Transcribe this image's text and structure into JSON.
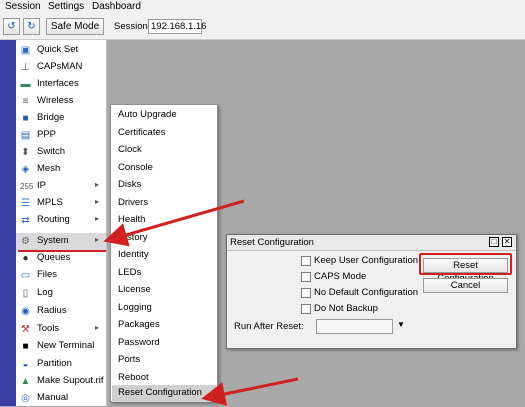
{
  "menubar": {
    "items": [
      "Session",
      "Settings",
      "Dashboard"
    ]
  },
  "toolbar": {
    "undo_icon": "undo-icon",
    "redo_icon": "redo-icon",
    "safe_mode_label": "Safe Mode",
    "session_label": "Session:",
    "session_value": "192.168.1.16"
  },
  "sidebar": {
    "items": [
      {
        "label": "Quick Set",
        "icon": "quick-set-icon",
        "submenu": false
      },
      {
        "label": "CAPsMAN",
        "icon": "capsman-icon",
        "submenu": false
      },
      {
        "label": "Interfaces",
        "icon": "interfaces-icon",
        "submenu": false
      },
      {
        "label": "Wireless",
        "icon": "wireless-icon",
        "submenu": false
      },
      {
        "label": "Bridge",
        "icon": "bridge-icon",
        "submenu": false
      },
      {
        "label": "PPP",
        "icon": "ppp-icon",
        "submenu": false
      },
      {
        "label": "Switch",
        "icon": "switch-icon",
        "submenu": false
      },
      {
        "label": "Mesh",
        "icon": "mesh-icon",
        "submenu": false
      },
      {
        "label": "IP",
        "icon": "ip-icon",
        "submenu": true
      },
      {
        "label": "MPLS",
        "icon": "mpls-icon",
        "submenu": true
      },
      {
        "label": "Routing",
        "icon": "routing-icon",
        "submenu": true
      },
      {
        "label": "System",
        "icon": "system-gear-icon",
        "submenu": true
      },
      {
        "label": "Queues",
        "icon": "queues-icon",
        "submenu": false
      },
      {
        "label": "Files",
        "icon": "files-icon",
        "submenu": false
      },
      {
        "label": "Log",
        "icon": "log-icon",
        "submenu": false
      },
      {
        "label": "Radius",
        "icon": "radius-icon",
        "submenu": false
      },
      {
        "label": "Tools",
        "icon": "tools-icon",
        "submenu": true
      },
      {
        "label": "New Terminal",
        "icon": "terminal-icon",
        "submenu": false
      },
      {
        "label": "Partition",
        "icon": "partition-icon",
        "submenu": false
      },
      {
        "label": "Make Supout.rif",
        "icon": "supout-icon",
        "submenu": false
      },
      {
        "label": "Manual",
        "icon": "manual-icon",
        "submenu": false
      }
    ]
  },
  "system_submenu": {
    "items": [
      "Auto Upgrade",
      "Certificates",
      "Clock",
      "Console",
      "Disks",
      "Drivers",
      "Health",
      "History",
      "Identity",
      "LEDs",
      "License",
      "Logging",
      "Packages",
      "Password",
      "Ports",
      "Reboot",
      "Reset Configuration"
    ]
  },
  "dialog": {
    "title": "Reset Configuration",
    "checkboxes": [
      "Keep User Configuration",
      "CAPS Mode",
      "No Default Configuration",
      "Do Not Backup"
    ],
    "reset_button": "Reset Configuration",
    "cancel_button": "Cancel",
    "run_after_reset_label": "Run After Reset:",
    "run_after_reset_value": ""
  },
  "colors": {
    "annotation_red": "#d02020",
    "side_strip": "#3a3fa8",
    "workspace": "#a9a9a9"
  }
}
